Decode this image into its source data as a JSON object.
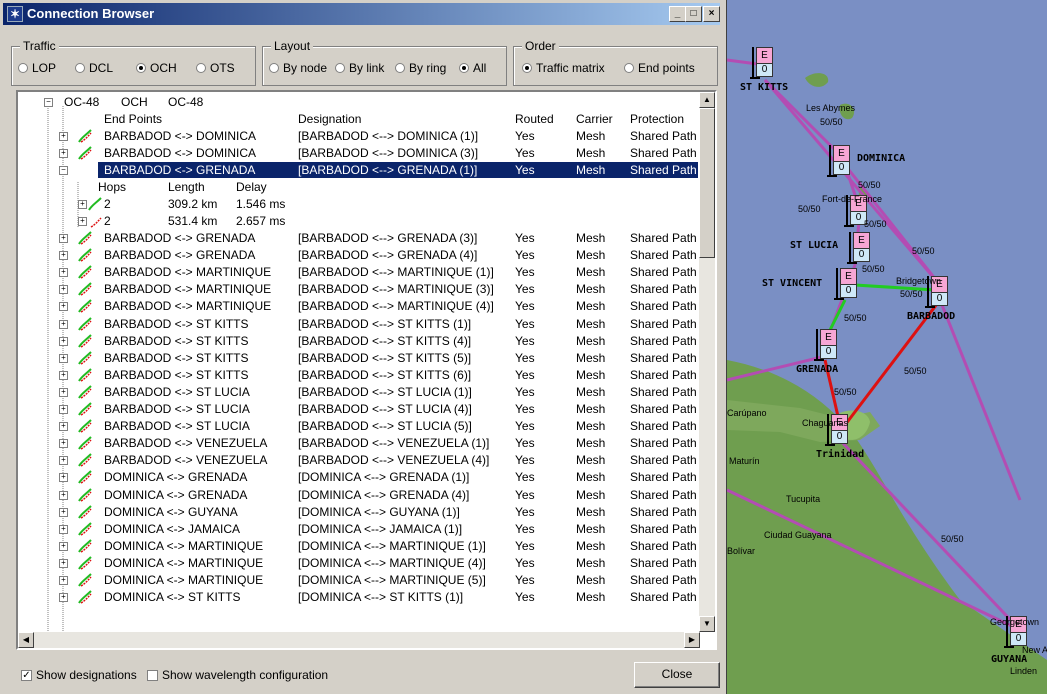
{
  "window": {
    "title": "Connection Browser",
    "minimize": "_",
    "maximize": "□",
    "close": "×"
  },
  "traffic": {
    "label": "Traffic",
    "options": [
      "LOP",
      "DCL",
      "OCH",
      "OTS"
    ],
    "selected": "OCH"
  },
  "layout": {
    "label": "Layout",
    "options": [
      "By node",
      "By link",
      "By ring",
      "All"
    ],
    "selected": "All"
  },
  "order": {
    "label": "Order",
    "options": [
      "Traffic matrix",
      "End points"
    ],
    "selected": "Traffic matrix"
  },
  "tree": {
    "root": {
      "col1": "OC-48",
      "col2": "OCH",
      "col3": "OC-48"
    },
    "headers": {
      "endpoints": "End Points",
      "designation": "Designation",
      "routed": "Routed",
      "carrier": "Carrier",
      "protection": "Protection"
    },
    "rows_top": [
      {
        "ep": "BARBADOD <-> DOMINICA",
        "des": "[BARBADOD <--> DOMINICA (1)]",
        "routed": "Yes",
        "carrier": "Mesh",
        "prot": "Shared Path"
      },
      {
        "ep": "BARBADOD <-> DOMINICA",
        "des": "[BARBADOD <--> DOMINICA (3)]",
        "routed": "Yes",
        "carrier": "Mesh",
        "prot": "Shared Path"
      }
    ],
    "selected": {
      "ep": "BARBADOD <-> GRENADA",
      "des": "[BARBADOD <--> GRENADA (1)]",
      "routed": "Yes",
      "carrier": "Mesh",
      "prot": "Shared Path"
    },
    "sub_headers": {
      "hops": "Hops",
      "length": "Length",
      "delay": "Delay"
    },
    "paths": [
      {
        "hops": "2",
        "length": "309.2 km",
        "delay": "1.546 ms"
      },
      {
        "hops": "2",
        "length": "531.4 km",
        "delay": "2.657 ms"
      }
    ],
    "rows": [
      {
        "ep": "BARBADOD <-> GRENADA",
        "des": "[BARBADOD <--> GRENADA (3)]",
        "routed": "Yes",
        "carrier": "Mesh",
        "prot": "Shared Path"
      },
      {
        "ep": "BARBADOD <-> GRENADA",
        "des": "[BARBADOD <--> GRENADA (4)]",
        "routed": "Yes",
        "carrier": "Mesh",
        "prot": "Shared Path"
      },
      {
        "ep": "BARBADOD <-> MARTINIQUE",
        "des": "[BARBADOD <--> MARTINIQUE (1)]",
        "routed": "Yes",
        "carrier": "Mesh",
        "prot": "Shared Path"
      },
      {
        "ep": "BARBADOD <-> MARTINIQUE",
        "des": "[BARBADOD <--> MARTINIQUE (3)]",
        "routed": "Yes",
        "carrier": "Mesh",
        "prot": "Shared Path"
      },
      {
        "ep": "BARBADOD <-> MARTINIQUE",
        "des": "[BARBADOD <--> MARTINIQUE (4)]",
        "routed": "Yes",
        "carrier": "Mesh",
        "prot": "Shared Path"
      },
      {
        "ep": "BARBADOD <-> ST KITTS",
        "des": "[BARBADOD <--> ST KITTS (1)]",
        "routed": "Yes",
        "carrier": "Mesh",
        "prot": "Shared Path"
      },
      {
        "ep": "BARBADOD <-> ST KITTS",
        "des": "[BARBADOD <--> ST KITTS (4)]",
        "routed": "Yes",
        "carrier": "Mesh",
        "prot": "Shared Path"
      },
      {
        "ep": "BARBADOD <-> ST KITTS",
        "des": "[BARBADOD <--> ST KITTS (5)]",
        "routed": "Yes",
        "carrier": "Mesh",
        "prot": "Shared Path"
      },
      {
        "ep": "BARBADOD <-> ST KITTS",
        "des": "[BARBADOD <--> ST KITTS (6)]",
        "routed": "Yes",
        "carrier": "Mesh",
        "prot": "Shared Path"
      },
      {
        "ep": "BARBADOD <-> ST LUCIA",
        "des": "[BARBADOD <--> ST LUCIA (1)]",
        "routed": "Yes",
        "carrier": "Mesh",
        "prot": "Shared Path"
      },
      {
        "ep": "BARBADOD <-> ST LUCIA",
        "des": "[BARBADOD <--> ST LUCIA (4)]",
        "routed": "Yes",
        "carrier": "Mesh",
        "prot": "Shared Path"
      },
      {
        "ep": "BARBADOD <-> ST LUCIA",
        "des": "[BARBADOD <--> ST LUCIA (5)]",
        "routed": "Yes",
        "carrier": "Mesh",
        "prot": "Shared Path"
      },
      {
        "ep": "BARBADOD <-> VENEZUELA",
        "des": "[BARBADOD <--> VENEZUELA (1)]",
        "routed": "Yes",
        "carrier": "Mesh",
        "prot": "Shared Path"
      },
      {
        "ep": "BARBADOD <-> VENEZUELA",
        "des": "[BARBADOD <--> VENEZUELA (4)]",
        "routed": "Yes",
        "carrier": "Mesh",
        "prot": "Shared Path"
      },
      {
        "ep": "DOMINICA <-> GRENADA",
        "des": "[DOMINICA <--> GRENADA (1)]",
        "routed": "Yes",
        "carrier": "Mesh",
        "prot": "Shared Path"
      },
      {
        "ep": "DOMINICA <-> GRENADA",
        "des": "[DOMINICA <--> GRENADA (4)]",
        "routed": "Yes",
        "carrier": "Mesh",
        "prot": "Shared Path"
      },
      {
        "ep": "DOMINICA <-> GUYANA",
        "des": "[DOMINICA <--> GUYANA (1)]",
        "routed": "Yes",
        "carrier": "Mesh",
        "prot": "Shared Path"
      },
      {
        "ep": "DOMINICA <-> JAMAICA",
        "des": "[DOMINICA <--> JAMAICA (1)]",
        "routed": "Yes",
        "carrier": "Mesh",
        "prot": "Shared Path"
      },
      {
        "ep": "DOMINICA <-> MARTINIQUE",
        "des": "[DOMINICA <--> MARTINIQUE (1)]",
        "routed": "Yes",
        "carrier": "Mesh",
        "prot": "Shared Path"
      },
      {
        "ep": "DOMINICA <-> MARTINIQUE",
        "des": "[DOMINICA <--> MARTINIQUE (4)]",
        "routed": "Yes",
        "carrier": "Mesh",
        "prot": "Shared Path"
      },
      {
        "ep": "DOMINICA <-> MARTINIQUE",
        "des": "[DOMINICA <--> MARTINIQUE (5)]",
        "routed": "Yes",
        "carrier": "Mesh",
        "prot": "Shared Path"
      },
      {
        "ep": "DOMINICA <-> ST KITTS",
        "des": "[DOMINICA <--> ST KITTS (1)]",
        "routed": "Yes",
        "carrier": "Mesh",
        "prot": "Shared Path"
      }
    ]
  },
  "footer": {
    "show_designations": "Show designations",
    "show_wavelength": "Show wavelength configuration",
    "close": "Close"
  },
  "map": {
    "node_e": "E",
    "node_o": "0",
    "nodes": {
      "st_kitts": "ST KITTS",
      "dominica": "DOMINICA",
      "st_lucia": "ST LUCIA",
      "st_vincent": "ST VINCENT",
      "barbadod": "BARBADOD",
      "grenada": "GRENADA",
      "trinidad": "Trinidad",
      "guyana": "GUYANA"
    },
    "places": {
      "les_abymes": "Les Abymes",
      "fort": "Fort-de-France",
      "bridgetown": "Bridgetown",
      "carupano": "Carúpano",
      "maturin": "Maturín",
      "tucupita": "Tucupita",
      "ciudad": "Ciudad Guayana",
      "bolivar": "Bolívar",
      "georgetown": "Georgetown",
      "new_am": "New Am",
      "linden": "Linden",
      "chaguanas": "Chaguanas"
    },
    "link_label": "50/50",
    "colors": {
      "link_purple": "#b34db3",
      "link_green": "#22cc22",
      "link_red": "#dd1111",
      "sea": "#7a8fc4",
      "land": "#6f9e4f"
    }
  }
}
